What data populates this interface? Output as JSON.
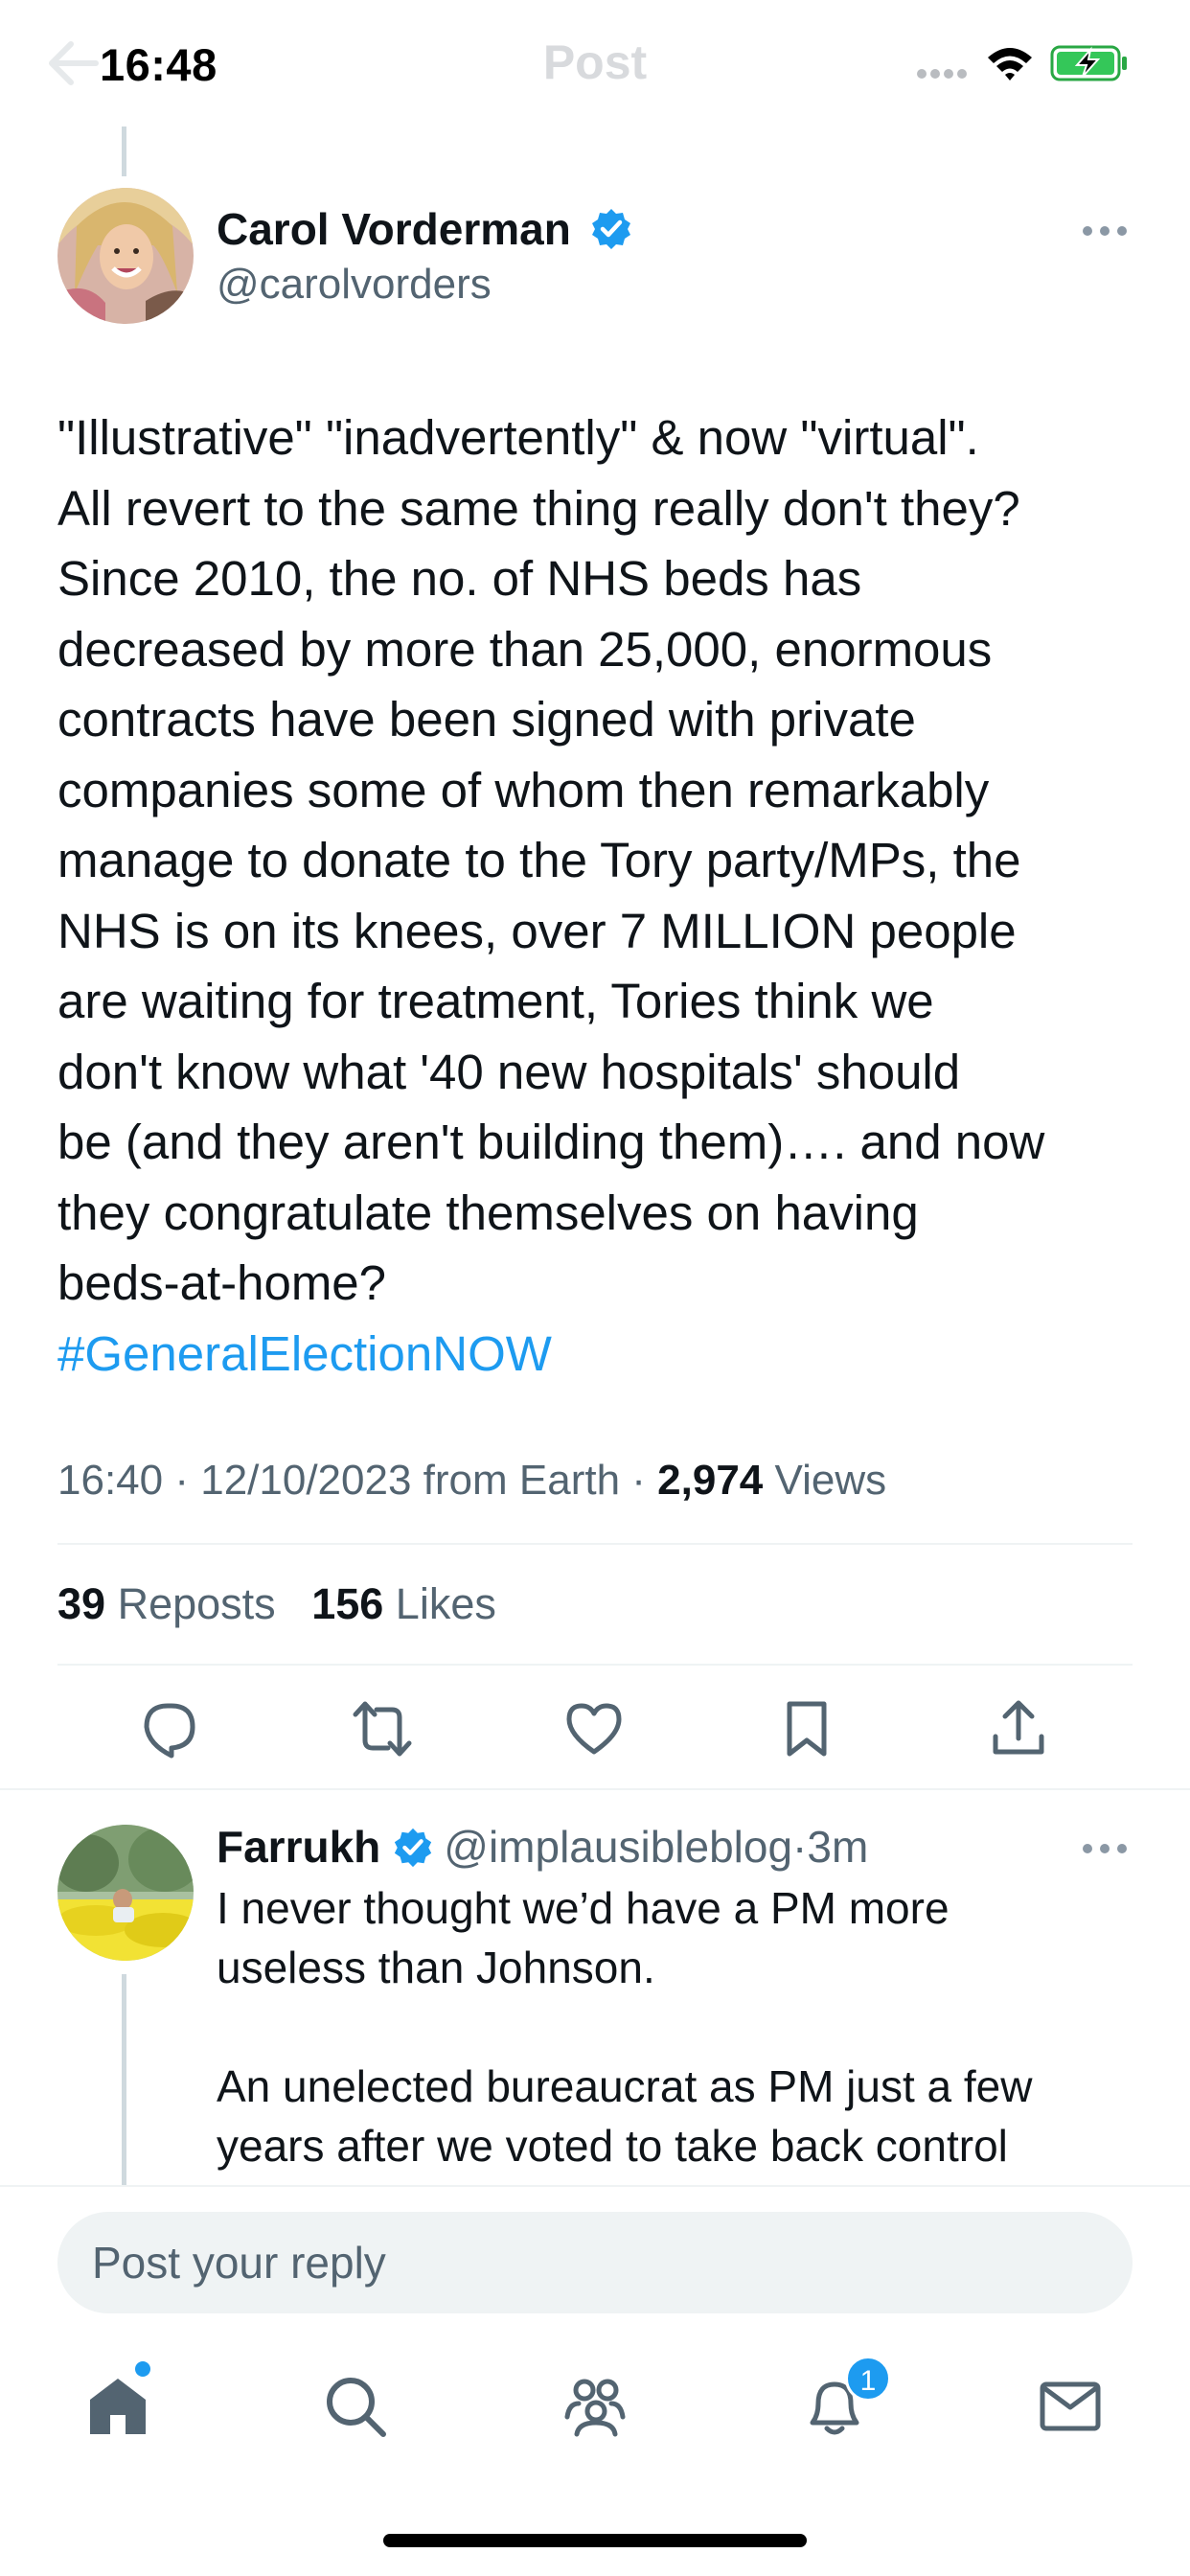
{
  "status_bar": {
    "time": "16:48",
    "icons": [
      "signal-icon",
      "wifi-icon",
      "battery-charging-icon"
    ]
  },
  "header": {
    "title": "Post",
    "back_icon": "back-arrow-icon"
  },
  "main_post": {
    "author_name": "Carol Vorderman",
    "author_handle": "@carolvorders",
    "verified": true,
    "text_lines": [
      "\"Illustrative\" \"inadvertently\" & now \"virtual\".",
      "All revert to the same thing really don't they?",
      "Since 2010, the no. of NHS beds has",
      "decreased by more than 25,000, enormous",
      "contracts have been signed with private",
      "companies some of whom then remarkably",
      "manage to donate to the Tory party/MPs, the",
      "NHS is on its knees, over 7 MILLION people",
      "are waiting for treatment, Tories think we",
      "don't know what '40 new hospitals' should",
      "be (and they aren't building them)…. and now",
      "they congratulate themselves on having",
      "beds-at-home?"
    ],
    "hashtag": "#GeneralElectionNOW",
    "meta": {
      "time": "16:40",
      "date": "12/10/2023",
      "source": "from Earth",
      "views_count": "2,974",
      "views_label": "Views"
    },
    "stats": {
      "reposts_count": "39",
      "reposts_label": "Reposts",
      "likes_count": "156",
      "likes_label": "Likes"
    },
    "actions": [
      "reply-icon",
      "repost-icon",
      "like-icon",
      "bookmark-icon",
      "share-icon"
    ]
  },
  "reply": {
    "author_name": "Farrukh",
    "author_handle": "@implausibleblog",
    "separator": "·",
    "time": "3m",
    "verified": true,
    "text_lines_1": [
      "I never thought we’d have a PM more",
      "useless than Johnson."
    ],
    "text_lines_2": [
      "An unelected bureaucrat as PM just a few",
      "years after we voted to take back control"
    ]
  },
  "reply_bar": {
    "placeholder": "Post your reply"
  },
  "tab_bar": {
    "tabs": [
      "home-icon",
      "search-icon",
      "communities-icon",
      "notifications-icon",
      "messages-icon"
    ],
    "notification_badge": "1"
  },
  "colors": {
    "accent": "#1d9bf0",
    "text_primary": "#0f1419",
    "text_secondary": "#536471",
    "divider": "#eff3f4"
  }
}
